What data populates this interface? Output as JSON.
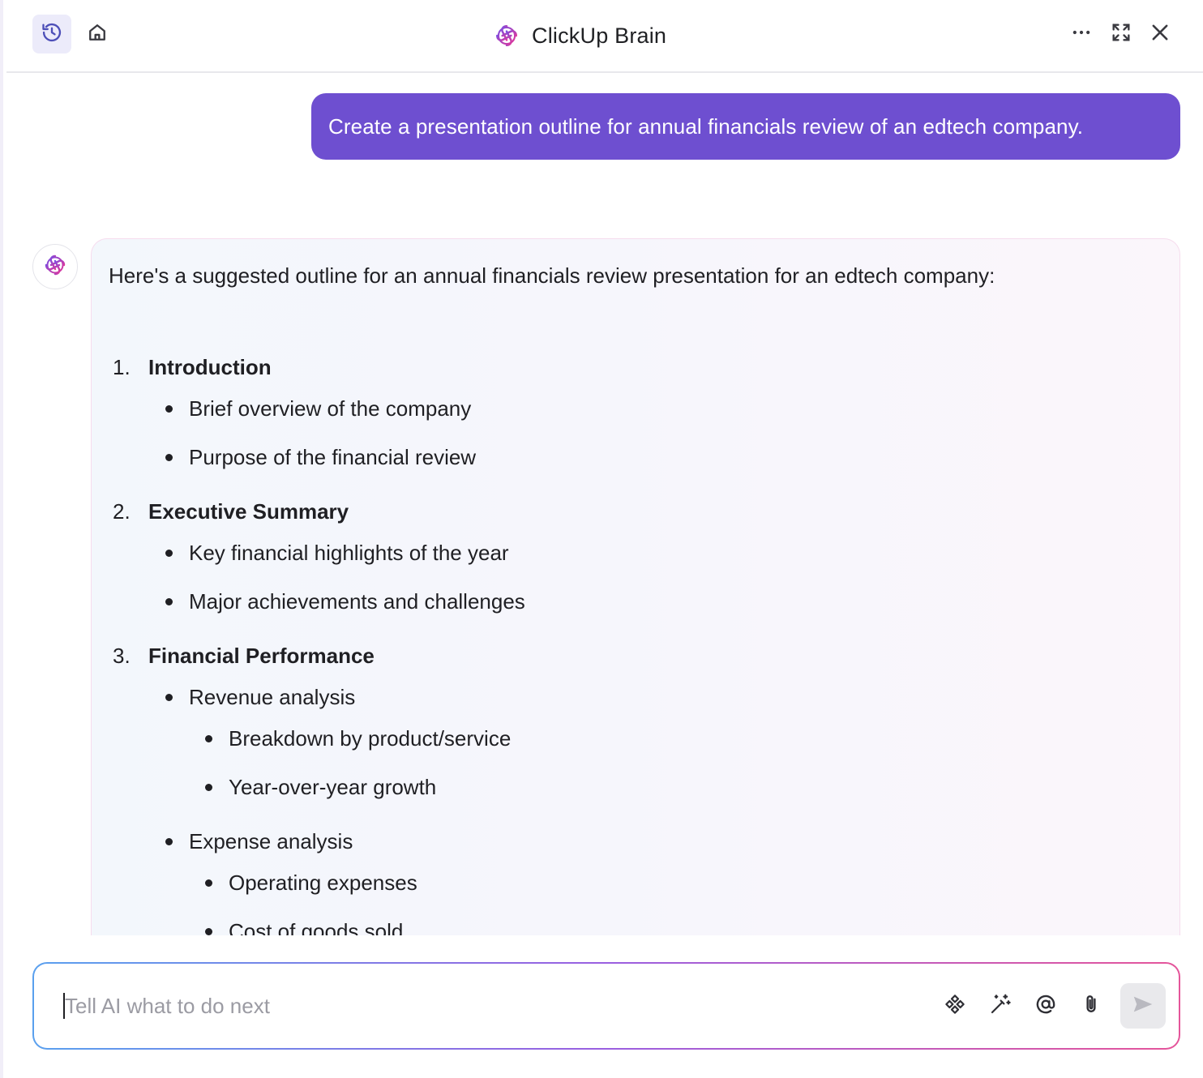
{
  "header": {
    "title": "ClickUp Brain",
    "icons": [
      "history-icon",
      "home-icon",
      "clickup-brain-logo",
      "more-icon",
      "expand-icon",
      "close-icon"
    ]
  },
  "conversation": {
    "user_message": "Create a presentation outline for annual financials review of an edtech company.",
    "ai_intro": "Here's a suggested outline for an annual financials review presentation for an edtech company:",
    "outline": [
      {
        "number": "1.",
        "heading": "Introduction",
        "bullets": [
          {
            "text": "Brief overview of the company"
          },
          {
            "text": "Purpose of the financial review"
          }
        ]
      },
      {
        "number": "2.",
        "heading": "Executive Summary",
        "bullets": [
          {
            "text": "Key financial highlights of the year"
          },
          {
            "text": "Major achievements and challenges"
          }
        ]
      },
      {
        "number": "3.",
        "heading": "Financial Performance",
        "bullets": [
          {
            "text": "Revenue analysis",
            "sub": [
              "Breakdown by product/service",
              "Year-over-year growth"
            ]
          },
          {
            "text": "Expense analysis",
            "sub": [
              "Operating expenses",
              "Cost of goods sold"
            ]
          }
        ]
      }
    ]
  },
  "input": {
    "placeholder": "Tell AI what to do next",
    "value": ""
  },
  "colors": {
    "user_bubble": "#6e4fd0",
    "accent_gradient": [
      "#5aa0ee",
      "#9a5fe0",
      "#e5559a"
    ],
    "history_button_bg": "#ecebfa"
  }
}
